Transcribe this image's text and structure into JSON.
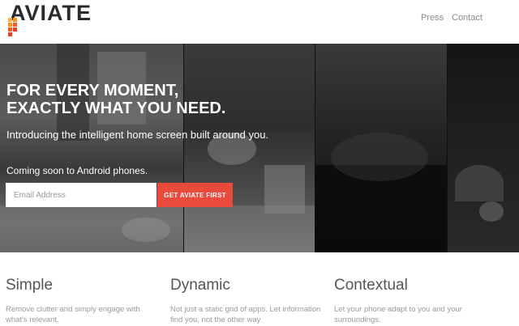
{
  "brand": {
    "logo_text": "AVIATE",
    "logo_colors": [
      "#f15a29",
      "#f7941d",
      "#fbb040",
      "#e8402f"
    ]
  },
  "nav": {
    "press": "Press",
    "contact": "Contact"
  },
  "hero": {
    "headline_line1": "FOR EVERY MOMENT,",
    "headline_line2": "EXACTLY WHAT YOU NEED.",
    "subhead": "Introducing the intelligent home screen built around you.",
    "coming_soon": "Coming soon to Android phones.",
    "email_placeholder": "Email Address",
    "cta_label": "GET AVIATE FIRST",
    "cta_color": "#ea4a3c"
  },
  "features": [
    {
      "title": "Simple",
      "desc": "Remove clutter and simply engage with what's relevant."
    },
    {
      "title": "Dynamic",
      "desc": "Not just a static grid of apps. Let information find you, not the other way"
    },
    {
      "title": "Contextual",
      "desc": "Let your phone adapt to you and your surroundings."
    }
  ]
}
